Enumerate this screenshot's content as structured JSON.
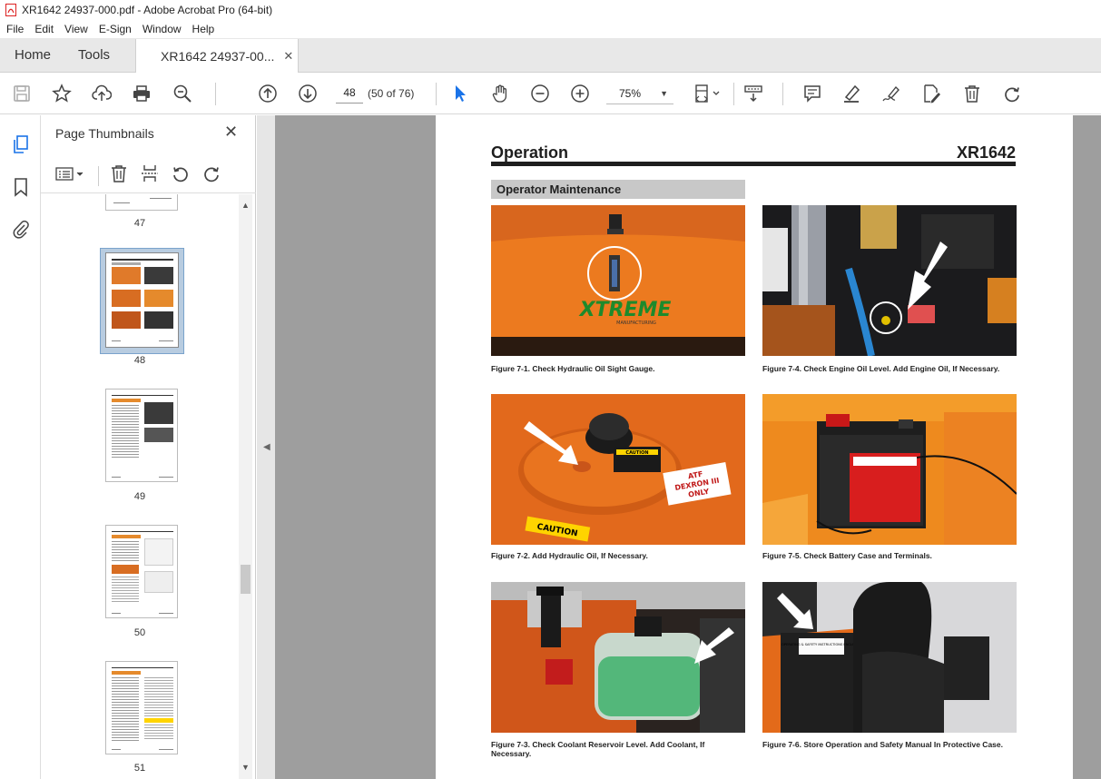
{
  "window": {
    "title": "XR1642 24937-000.pdf - Adobe Acrobat Pro (64-bit)"
  },
  "menu": {
    "items": [
      "File",
      "Edit",
      "View",
      "E-Sign",
      "Window",
      "Help"
    ]
  },
  "tabs": {
    "home": "Home",
    "tools": "Tools",
    "doc": "XR1642 24937-00..."
  },
  "toolbar": {
    "page_number": "48",
    "page_count": "(50 of 76)",
    "zoom": "75%"
  },
  "panel": {
    "title": "Page Thumbnails",
    "thumbnails": [
      {
        "label": "47"
      },
      {
        "label": "48"
      },
      {
        "label": "49"
      },
      {
        "label": "50"
      },
      {
        "label": "51"
      }
    ]
  },
  "document": {
    "header_left": "Operation",
    "header_right": "XR1642",
    "section": "Operator Maintenance",
    "figures": [
      {
        "caption": "Figure 7-1.  Check Hydraulic Oil Sight Gauge."
      },
      {
        "caption": "Figure 7-4.  Check Engine Oil Level.  Add Engine Oil, If Necessary."
      },
      {
        "caption": "Figure 7-2.  Add Hydraulic Oil, If Necessary."
      },
      {
        "caption": "Figure 7-5.  Check Battery Case and Terminals."
      },
      {
        "caption": "Figure 7-3.  Check Coolant Reservoir Level.  Add Coolant, If Necessary."
      },
      {
        "caption": "Figure 7-6.  Store Operation and Safety Manual In Protective Case."
      }
    ],
    "photo_text": {
      "logo": "XTREME",
      "logo_sub": "MANUFACTURING",
      "caution": "CAUTION",
      "atf_line1": "ATF",
      "atf_line2": "DEXRON III",
      "atf_line3": "ONLY",
      "manual_label": "OPERATING & SAFETY INSTRUCTIONS ENCLOSED"
    }
  },
  "colors": {
    "accent": "#1a73e8",
    "orange": "#e8741c",
    "page_bg": "#9e9e9e"
  }
}
